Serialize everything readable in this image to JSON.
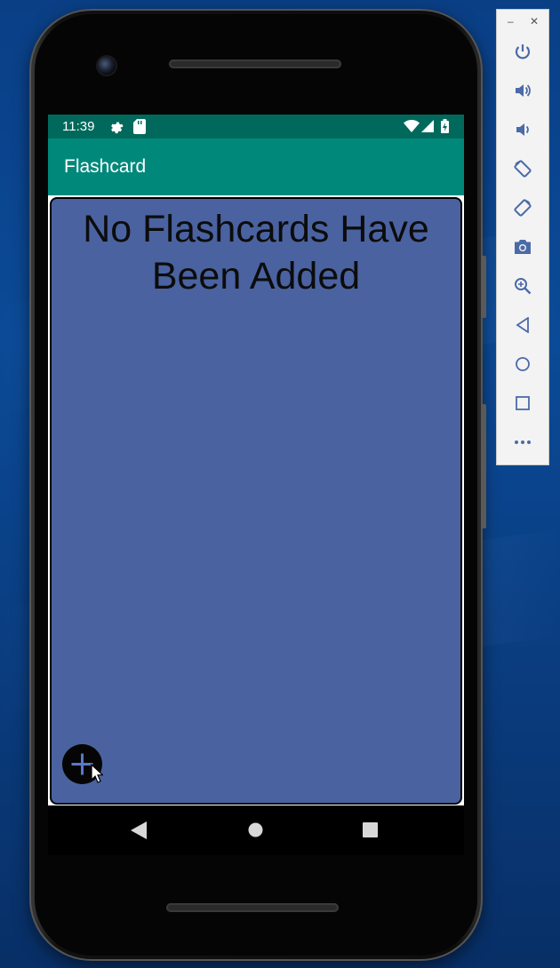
{
  "statusbar": {
    "time": "11:39",
    "icons": [
      "gear-icon",
      "sd-card-icon",
      "wifi-icon",
      "cellular-signal-icon",
      "battery-icon"
    ]
  },
  "appbar": {
    "title": "Flashcard"
  },
  "main": {
    "empty_message": "No Flashcards Have Been Added",
    "fab_icon": "plus-icon"
  },
  "navbar": {
    "buttons": [
      "back-icon",
      "home-icon",
      "recents-icon"
    ]
  },
  "emulator_toolbar": {
    "window_controls": [
      "minimize-icon",
      "close-icon"
    ],
    "items": [
      "power-icon",
      "volume-up-icon",
      "volume-down-icon",
      "rotate-left-icon",
      "rotate-right-icon",
      "camera-icon",
      "zoom-icon",
      "back-icon",
      "home-icon",
      "overview-icon",
      "more-icon"
    ]
  },
  "colors": {
    "status_bar": "#00695c",
    "app_bar": "#00897b",
    "card_background": "#4a62a0",
    "fab": "#050505",
    "desktop": "#0a3f86"
  }
}
